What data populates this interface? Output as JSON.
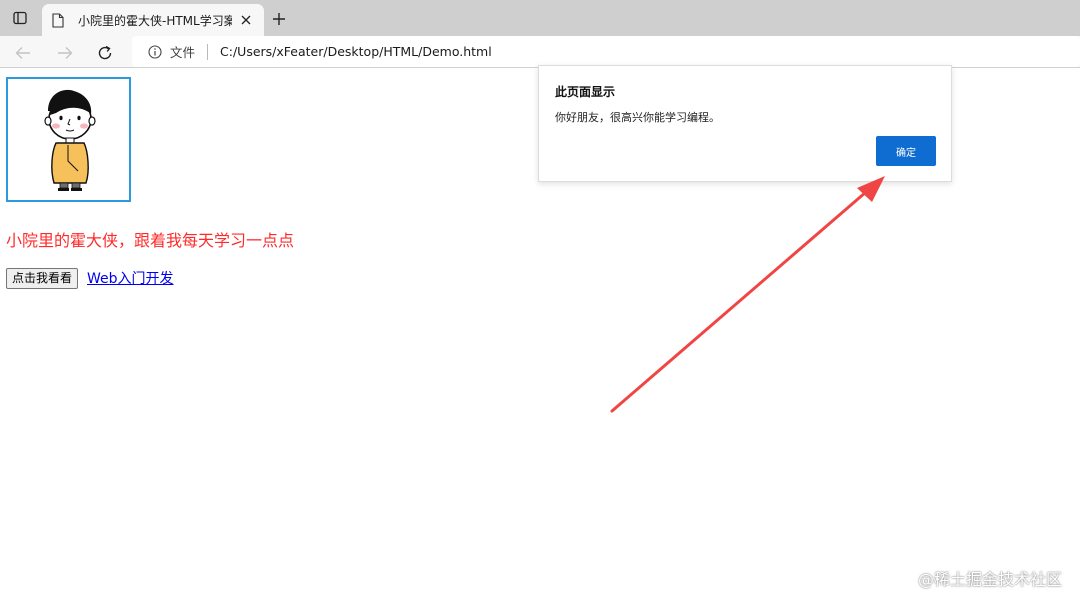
{
  "browser": {
    "tab_title": "小院里的霍大侠-HTML学习案例",
    "address_protocol_label": "文件",
    "address_url": "C:/Users/xFeater/Desktop/HTML/Demo.html",
    "icons": [
      "tab-actions-icon",
      "document-icon",
      "close-icon",
      "plus-icon",
      "back-arrow-icon",
      "forward-arrow-icon",
      "refresh-icon",
      "info-icon"
    ]
  },
  "page": {
    "heading": "小院里的霍大侠，跟着我每天学习一点点",
    "button_label": "点击我看看",
    "link_text": "Web入门开发"
  },
  "dialog": {
    "title": "此页面显示",
    "message": "你好朋友，很高兴你能学习编程。",
    "ok_label": "确定"
  },
  "annotation": {
    "arrow_color": "#f04545"
  },
  "watermark": "@稀土掘金技术社区",
  "colors": {
    "heading": "#ff2b2b",
    "link": "#0000ee",
    "ok_button": "#0f6cd0",
    "avatar_border": "#2b9be0"
  }
}
